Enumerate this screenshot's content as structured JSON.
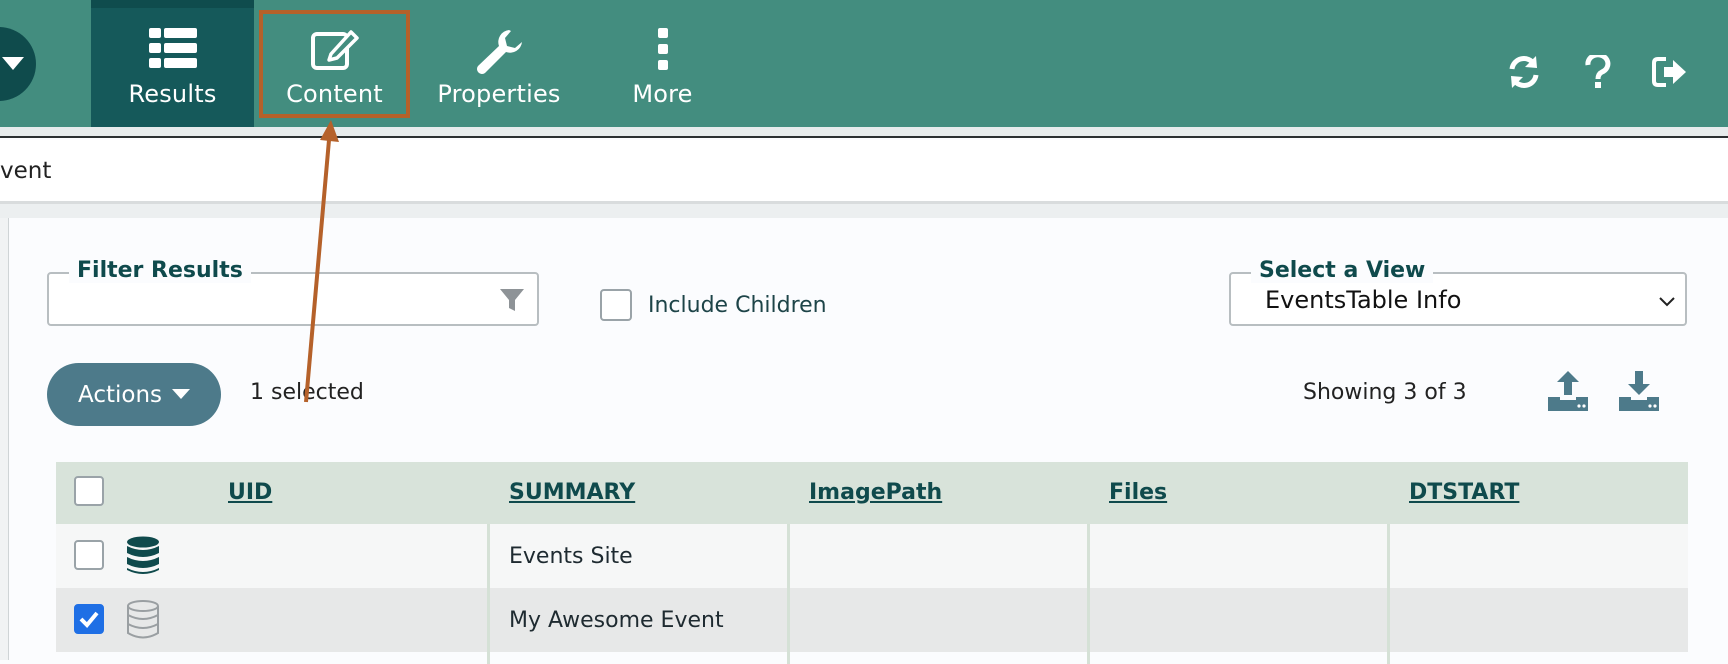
{
  "nav": {
    "items": [
      {
        "label": "Results",
        "icon": "list-icon"
      },
      {
        "label": "Content",
        "icon": "edit-icon"
      },
      {
        "label": "Properties",
        "icon": "wrench-icon"
      },
      {
        "label": "More",
        "icon": "more-vertical-icon"
      }
    ],
    "right_icons": [
      "refresh-icon",
      "help-icon",
      "logout-icon"
    ]
  },
  "breadcrumb": {
    "text": "vent"
  },
  "filter": {
    "legend": "Filter Results",
    "value": ""
  },
  "include_children": {
    "label": "Include Children",
    "checked": false
  },
  "view": {
    "legend": "Select a View",
    "value": "EventsTable Info"
  },
  "actions": {
    "label": "Actions",
    "selected_text": "1 selected"
  },
  "showing": {
    "text": "Showing 3 of 3"
  },
  "table": {
    "headers": [
      "UID",
      "SUMMARY",
      "ImagePath",
      "Files",
      "DTSTART"
    ],
    "rows": [
      {
        "checked": false,
        "icon": "database-icon",
        "summary": "Events Site"
      },
      {
        "checked": true,
        "icon": "database-outline-icon",
        "summary": "My Awesome Event"
      }
    ]
  },
  "colors": {
    "topbar": "#438d7f",
    "active_tab": "#15595a",
    "highlight": "#b5612a",
    "actions_button": "#4d7a8a",
    "header_row": "#d8e3da"
  }
}
